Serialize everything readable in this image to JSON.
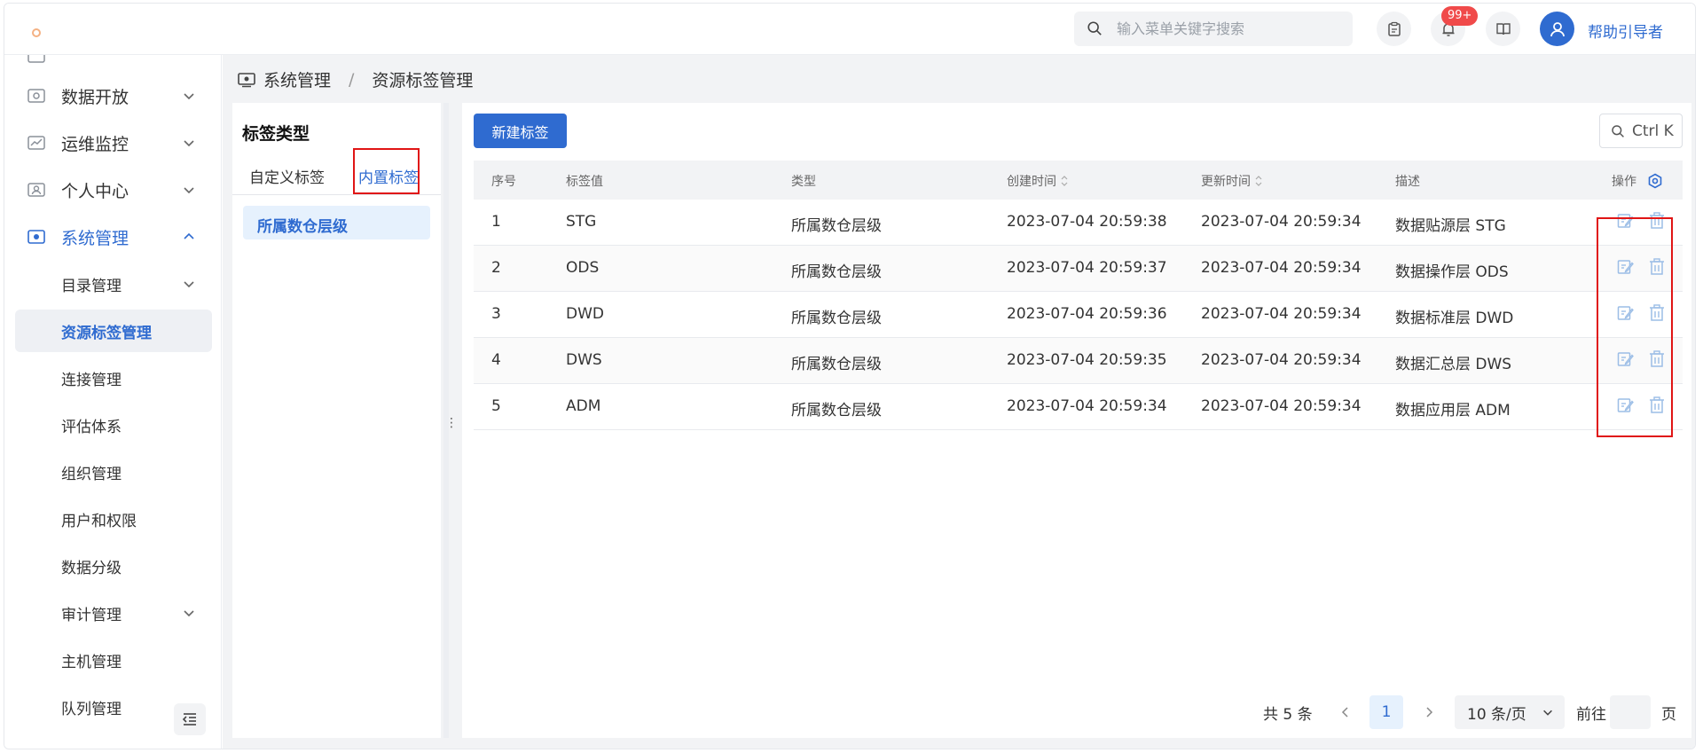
{
  "header": {
    "search_placeholder": "输入菜单关键字搜索",
    "notification_badge": "99+",
    "user_name": "帮助引导者"
  },
  "sidebar": {
    "items": [
      {
        "label": "数据开放",
        "icon": "data-open-icon",
        "expanded": false
      },
      {
        "label": "运维监控",
        "icon": "monitor-chart-icon",
        "expanded": false
      },
      {
        "label": "个人中心",
        "icon": "user-card-icon",
        "expanded": false
      },
      {
        "label": "系统管理",
        "icon": "system-admin-icon",
        "expanded": true
      }
    ],
    "subitems": [
      {
        "label": "目录管理",
        "has_children": true
      },
      {
        "label": "资源标签管理",
        "active": true
      },
      {
        "label": "连接管理"
      },
      {
        "label": "评估体系"
      },
      {
        "label": "组织管理"
      },
      {
        "label": "用户和权限"
      },
      {
        "label": "数据分级"
      },
      {
        "label": "审计管理",
        "has_children": true
      },
      {
        "label": "主机管理"
      },
      {
        "label": "队列管理"
      }
    ]
  },
  "breadcrumb": {
    "root": "系统管理",
    "separator": "/",
    "current": "资源标签管理"
  },
  "left_panel": {
    "title": "标签类型",
    "tabs": [
      {
        "label": "自定义标签",
        "active": false
      },
      {
        "label": "内置标签",
        "active": true
      }
    ],
    "selected_item": "所属数仓层级"
  },
  "toolbar": {
    "new_button": "新建标签",
    "shortcut_label": "Ctrl K"
  },
  "table": {
    "columns": [
      "序号",
      "标签值",
      "类型",
      "创建时间",
      "更新时间",
      "描述",
      "操作"
    ],
    "rows": [
      {
        "no": "1",
        "value": "STG",
        "type": "所属数仓层级",
        "created": "2023-07-04 20:59:38",
        "updated": "2023-07-04 20:59:34",
        "desc": "数据贴源层 STG"
      },
      {
        "no": "2",
        "value": "ODS",
        "type": "所属数仓层级",
        "created": "2023-07-04 20:59:37",
        "updated": "2023-07-04 20:59:34",
        "desc": "数据操作层 ODS"
      },
      {
        "no": "3",
        "value": "DWD",
        "type": "所属数仓层级",
        "created": "2023-07-04 20:59:36",
        "updated": "2023-07-04 20:59:34",
        "desc": "数据标准层 DWD"
      },
      {
        "no": "4",
        "value": "DWS",
        "type": "所属数仓层级",
        "created": "2023-07-04 20:59:35",
        "updated": "2023-07-04 20:59:34",
        "desc": "数据汇总层 DWS"
      },
      {
        "no": "5",
        "value": "ADM",
        "type": "所属数仓层级",
        "created": "2023-07-04 20:59:34",
        "updated": "2023-07-04 20:59:34",
        "desc": "数据应用层 ADM"
      }
    ]
  },
  "pagination": {
    "total": "共 5 条",
    "current_page": "1",
    "page_size": "10 条/页",
    "goto_label": "前往",
    "page_suffix": "页"
  },
  "colors": {
    "primary": "#2f6bd0",
    "highlight_border": "#e01515",
    "badge": "#f04a4a"
  }
}
